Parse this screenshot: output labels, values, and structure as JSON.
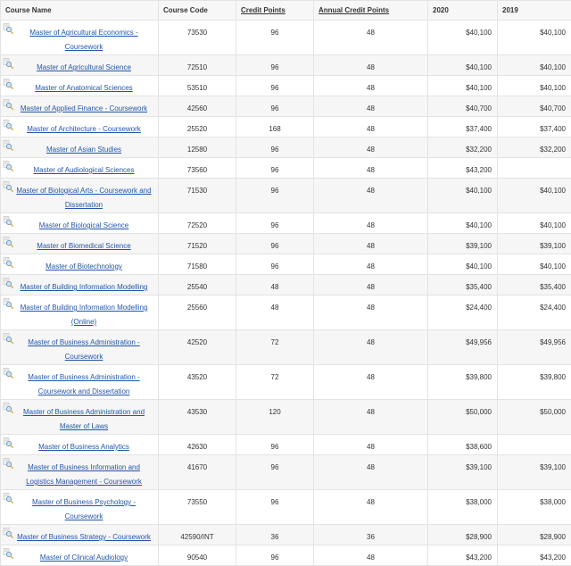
{
  "table": {
    "headers": {
      "course_name": "Course Name",
      "course_code": "Course Code",
      "credit_points": "Credit Points",
      "annual_credit_points": "Annual Credit Points",
      "year_2020": "2020",
      "year_2019": "2019"
    },
    "rows": [
      {
        "name": "Master of Agricultural Economics - Coursework",
        "code": "73530",
        "credit": "96",
        "annual": "48",
        "fee2020": "$40,100",
        "fee2019": "$40,100",
        "icon": "magnifier-info-icon"
      },
      {
        "name": "Master of Agricultural Science",
        "code": "72510",
        "credit": "96",
        "annual": "48",
        "fee2020": "$40,100",
        "fee2019": "$40,100",
        "icon": "magnifier-info-icon"
      },
      {
        "name": "Master of Anatomical Sciences",
        "code": "53510",
        "credit": "96",
        "annual": "48",
        "fee2020": "$40,100",
        "fee2019": "$40,100",
        "icon": "magnifier-info-icon"
      },
      {
        "name": "Master of Applied Finance - Coursework",
        "code": "42560",
        "credit": "96",
        "annual": "48",
        "fee2020": "$40,700",
        "fee2019": "$40,700",
        "icon": "magnifier-info-icon"
      },
      {
        "name": "Master of Architecture - Coursework",
        "code": "25520",
        "credit": "168",
        "annual": "48",
        "fee2020": "$37,400",
        "fee2019": "$37,400",
        "icon": "magnifier-info-icon"
      },
      {
        "name": "Master of Asian Studies",
        "code": "12580",
        "credit": "96",
        "annual": "48",
        "fee2020": "$32,200",
        "fee2019": "$32,200",
        "icon": "magnifier-info-icon"
      },
      {
        "name": "Master of Audiological Sciences",
        "code": "73560",
        "credit": "96",
        "annual": "48",
        "fee2020": "$43,200",
        "fee2019": "",
        "icon": "magnifier-info-icon"
      },
      {
        "name": "Master of Biological Arts - Coursework and Dissertation",
        "code": "71530",
        "credit": "96",
        "annual": "48",
        "fee2020": "$40,100",
        "fee2019": "$40,100",
        "icon": "magnifier-info-icon"
      },
      {
        "name": "Master of Biological Science",
        "code": "72520",
        "credit": "96",
        "annual": "48",
        "fee2020": "$40,100",
        "fee2019": "$40,100",
        "icon": "magnifier-info-icon"
      },
      {
        "name": "Master of Biomedical Science",
        "code": "71520",
        "credit": "96",
        "annual": "48",
        "fee2020": "$39,100",
        "fee2019": "$39,100",
        "icon": "magnifier-info-icon"
      },
      {
        "name": "Master of Biotechnology",
        "code": "71580",
        "credit": "96",
        "annual": "48",
        "fee2020": "$40,100",
        "fee2019": "$40,100",
        "icon": "magnifier-info-icon"
      },
      {
        "name": "Master of Building Information Modelling",
        "code": "25540",
        "credit": "48",
        "annual": "48",
        "fee2020": "$35,400",
        "fee2019": "$35,400",
        "icon": "magnifier-info-icon"
      },
      {
        "name": "Master of Building Information Modelling (Online)",
        "code": "25560",
        "credit": "48",
        "annual": "48",
        "fee2020": "$24,400",
        "fee2019": "$24,400",
        "icon": "magnifier-info-icon"
      },
      {
        "name": "Master of Business Administration - Coursework",
        "code": "42520",
        "credit": "72",
        "annual": "48",
        "fee2020": "$49,956",
        "fee2019": "$49,956",
        "icon": "magnifier-info-icon"
      },
      {
        "name": "Master of Business Administration - Coursework and Dissertation",
        "code": "43520",
        "credit": "72",
        "annual": "48",
        "fee2020": "$39,800",
        "fee2019": "$39,800",
        "icon": "magnifier-info-icon"
      },
      {
        "name": "Master of Business Administration and Master of Laws",
        "code": "43530",
        "credit": "120",
        "annual": "48",
        "fee2020": "$50,000",
        "fee2019": "$50,000",
        "icon": "magnifier-info-icon"
      },
      {
        "name": "Master of Business Analytics",
        "code": "42630",
        "credit": "96",
        "annual": "48",
        "fee2020": "$38,600",
        "fee2019": "",
        "icon": "magnifier-info-icon"
      },
      {
        "name": "Master of Business Information and Logistics Management - Coursework",
        "code": "41670",
        "credit": "96",
        "annual": "48",
        "fee2020": "$39,100",
        "fee2019": "$39,100",
        "icon": "magnifier-info-icon"
      },
      {
        "name": "Master of Business Psychology - Coursework",
        "code": "73550",
        "credit": "96",
        "annual": "48",
        "fee2020": "$38,000",
        "fee2019": "$38,000",
        "icon": "magnifier-info-icon"
      },
      {
        "name": "Master of Business Strategy - Coursework",
        "code": "42590/INT",
        "credit": "36",
        "annual": "36",
        "fee2020": "$28,900",
        "fee2019": "$28,900",
        "icon": "magnifier-info-icon"
      },
      {
        "name": "Master of Clinical Audiology",
        "code": "90540",
        "credit": "96",
        "annual": "48",
        "fee2020": "$43,200",
        "fee2019": "$43,200",
        "icon": "magnifier-info-icon"
      }
    ]
  }
}
